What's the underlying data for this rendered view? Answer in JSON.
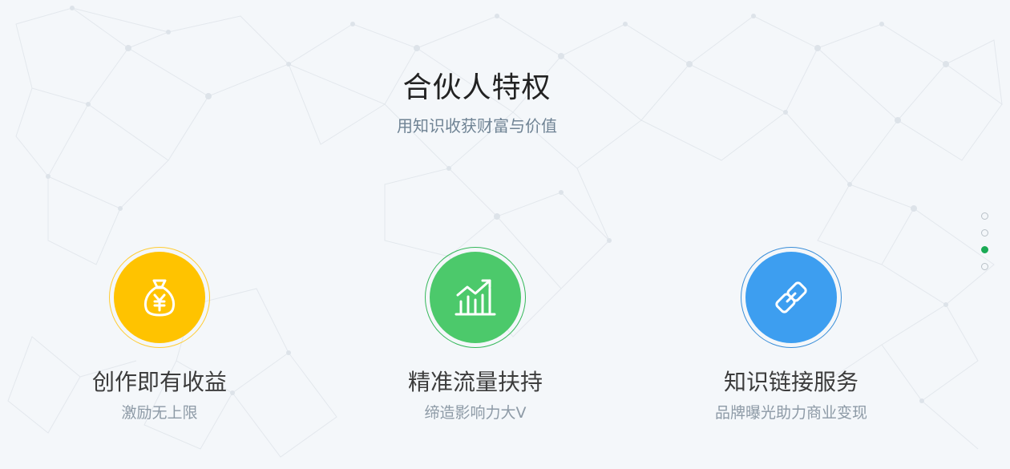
{
  "section": {
    "title": "合伙人特权",
    "subtitle": "用知识收获财富与价值"
  },
  "features": [
    {
      "title": "创作即有收益",
      "desc": "激励无上限",
      "icon": "money-bag-icon",
      "color": "#ffc300",
      "ring_color": "#ffcc33"
    },
    {
      "title": "精准流量扶持",
      "desc": "缔造影响力大V",
      "icon": "trend-chart-icon",
      "color": "#4cc96b",
      "ring_color": "#35b85a"
    },
    {
      "title": "知识链接服务",
      "desc": "品牌曝光助力商业变现",
      "icon": "link-chain-icon",
      "color": "#3d9ef0",
      "ring_color": "#3a8ed8"
    }
  ],
  "pagination": {
    "total": 4,
    "active_index": 2,
    "active_color": "#1aaa55"
  }
}
